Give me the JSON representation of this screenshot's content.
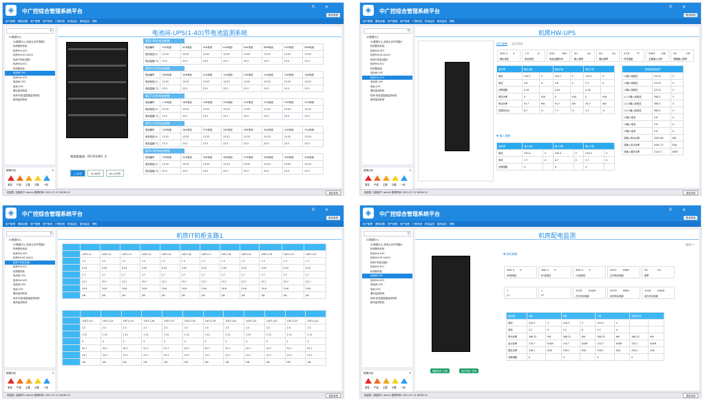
{
  "app": {
    "title": "中广控综合管理系统平台",
    "exit": "退出系统",
    "status": "欢迎您: 当前用户: admin   登录时间: 2021-07-12 08:56:10",
    "status_btn": "退出系统"
  },
  "menu": [
    "用户管理",
    "基础设置",
    "资产管理",
    "资产报表",
    "门禁系统",
    "机柜监控",
    "模块监控",
    "帮助"
  ],
  "tree": [
    {
      "l": "XX数据中心",
      "sub": false
    },
    {
      "l": "XX数据中心-机房主仓环境展示",
      "sub": true
    },
    {
      "l": "机房配电系统",
      "sub": true
    },
    {
      "l": "机房HW-UPS",
      "sub": true
    },
    {
      "l": "机房HW-KT-A0001",
      "sub": true
    },
    {
      "l": "机房IT机柜支路1",
      "sub": true
    },
    {
      "l": "机房HW-ECC",
      "sub": true
    },
    {
      "l": "机房配电柜",
      "sub": true
    },
    {
      "l": "电池间-UPS",
      "sub": true
    },
    {
      "l": "机房HW-UPS",
      "sub": true
    },
    {
      "l": "电池间-UPS",
      "sub": true
    },
    {
      "l": "电池-UPS",
      "sub": true
    },
    {
      "l": "漏水监测系统",
      "sub": true
    },
    {
      "l": "机房-机柜温湿度监测系统",
      "sub": true
    },
    {
      "l": "新风监测系统",
      "sub": true
    }
  ],
  "alarms": {
    "title": "报警分析",
    "count": "0",
    "labels": [
      "紧急",
      "严重",
      "主要",
      "次要",
      "一般"
    ],
    "colors": [
      "#e8262a",
      "#f36b1c",
      "#f5a31a",
      "#f5d21a",
      "#2a9df4"
    ]
  },
  "p1": {
    "title": "电池间-UPS(1-40)节电池监测系统",
    "battery_label": "电池组电流:",
    "battery_value": "DCV01081",
    "battery_unit": "A",
    "buttons": [
      "1-40节",
      "41-80节",
      "81-120节"
    ],
    "groups": [
      {
        "title": "第01-08节电池参数",
        "start": 1
      },
      {
        "title": "第09-16节电池参数",
        "start": 9
      },
      {
        "title": "第17-24节电池参数",
        "start": 17
      },
      {
        "title": "第25-32节电池参数",
        "start": 25
      },
      {
        "title": "第33-40节电池参数",
        "start": 33
      }
    ],
    "row_labels": [
      "电池编号",
      "电池电压(V)",
      "电池温度(℃)"
    ],
    "volt": "13.53",
    "temp": "23.3"
  },
  "p2": {
    "title": "机房HW-UPS",
    "tabs": [
      "运行参数",
      "运行状态"
    ],
    "params": [
      {
        "v": "400.3",
        "u": "V",
        "l": "输出电压"
      },
      {
        "v": "1.5",
        "u": "A",
        "l": "电池电流"
      },
      {
        "v": "200",
        "u": "Min",
        "l": "电池后备时间"
      },
      {
        "v": "50",
        "u": "Hz",
        "l": "输入频率"
      },
      {
        "v": "50",
        "u": "Hz",
        "l": "输出频率"
      },
      {
        "v": "23.8",
        "u": "℃",
        "l": "环境温度"
      },
      {
        "v": "5567",
        "u": "KW",
        "l": "主路输入功率"
      },
      {
        "v": "50",
        "u": "HZ",
        "l": "旁路输入频率"
      }
    ],
    "out_head": [
      "监测项",
      "输出A相",
      "输出B相",
      "输出C相"
    ],
    "out_rows": [
      [
        "电压",
        "220.2",
        "V",
        "220.1",
        "V",
        "220.3",
        "V"
      ],
      [
        "电流",
        "4.6",
        "A",
        "5.6",
        "A",
        "3.3",
        "A"
      ],
      [
        "功率因数",
        "0.16",
        "",
        "0.16",
        "",
        "0.16",
        ""
      ],
      [
        "视在功率",
        "0",
        "KVA",
        "0",
        "KVA",
        "0",
        "KVA"
      ],
      [
        "有功功率",
        "34.7",
        "KW",
        "34.7",
        "KW",
        "34.7",
        "KW"
      ],
      [
        "负载百分比",
        "6.7",
        "%",
        "7.3",
        "%",
        "5.2",
        "%"
      ]
    ],
    "in_title": "输入参数",
    "in_head": [
      "监测项",
      "输入A相",
      "输入B相",
      "输入C相"
    ],
    "in_rows": [
      [
        "电压",
        "220.4",
        "V",
        "220.4",
        "V",
        "220.4",
        "V"
      ],
      [
        "电流",
        "3.7",
        "A",
        "6.7",
        "A",
        "4.7",
        "A"
      ],
      [
        "功率因数",
        "0",
        "",
        "0",
        "",
        "0",
        ""
      ]
    ],
    "right_head": "其他参数监测项",
    "right_rows": [
      [
        "L1输入相电压",
        "221.6",
        "V"
      ],
      [
        "L2输入相电压",
        "221.6",
        "V"
      ],
      [
        "L3输入相电压",
        "221.6",
        "V"
      ],
      [
        "L1-L2输入线电压",
        "380.4",
        "V"
      ],
      [
        "L2-L3输入线电压",
        "380.4",
        "V"
      ],
      [
        "L3-L1输入线电压",
        "380.4",
        "V"
      ],
      [
        "L1输入电流",
        "5.8",
        "A"
      ],
      [
        "L2输入电流",
        "5.8",
        "A"
      ],
      [
        "L3输入电流",
        "5.8",
        "A"
      ],
      [
        "总输入有功功率",
        "3267.88",
        "KW"
      ],
      [
        "总输入无功功率",
        "4502.13",
        "KVA"
      ],
      [
        "总输入视在功率",
        "2134.7",
        "KWH"
      ]
    ]
  },
  "p3": {
    "title": "机房IT机柜支路1",
    "row_labels": [
      "",
      "",
      "",
      "",
      "",
      "",
      ""
    ],
    "t1_names": [
      "1QF1-L1",
      "1QF1-L2",
      "1QF1-L3",
      "1QF1-L4",
      "1QF1-L5",
      "1QF1-L6",
      "1QF1-L7",
      "1QF1-L8",
      "1QF1-L9",
      "1QF1-L10",
      "1QF1-L11",
      "1QF1-L12"
    ],
    "t1_rows": [
      "1.3",
      "0.43",
      "2.7",
      "23.7",
      "24.6",
      "ON"
    ],
    "t2_names": [
      "1QF1-L13",
      "1QF1-L14",
      "1QF1-L15",
      "1QF1-L16",
      "1QF1-L17",
      "1QF1-L18",
      "1QF1-L19",
      "1QF1-L20",
      "1QF1-L21",
      "1QF1-L22",
      "1QF1-L23",
      "1QF1-L24"
    ],
    "t2_rows": [
      "2.5",
      "1.12",
      "5",
      "52.7",
      "23.7",
      "ON"
    ]
  },
  "p4": {
    "title": "机房配电监测",
    "back": "返回>>",
    "section": "实时参数",
    "btn1": "储能状态: 正常",
    "btn2": "运行状态: 正常",
    "boxes1": [
      {
        "v": "380.3",
        "u": "V",
        "l": "AB线电压"
      },
      {
        "v": "380.3",
        "u": "V",
        "l": "BC线电压"
      },
      {
        "v": "380.3",
        "u": "V",
        "l": "CA线电压"
      },
      {
        "v": "2031",
        "u": "KWH",
        "l": "正向有功电能"
      },
      {
        "v": "50",
        "u": "Hz",
        "l": "频率"
      }
    ],
    "boxes2": [
      {
        "v": "1",
        "u": "",
        "l": "CT"
      },
      {
        "v": "1",
        "u": "",
        "l": "PT"
      },
      {
        "v": "1032",
        "u": "KVAR",
        "l": "正向无功电能"
      },
      {
        "v": "2033",
        "u": "KWH",
        "l": "反向有功电能"
      },
      {
        "v": "1034",
        "u": "KVAR",
        "l": "反向无功电能"
      }
    ],
    "head": [
      "监测项",
      "A相",
      "B相",
      "C相",
      "总或/平均"
    ],
    "rows": [
      [
        "电压",
        "220.3",
        "V",
        "220.3",
        "V",
        "220.3",
        "V",
        "",
        ""
      ],
      [
        "电流",
        "5.2",
        "A",
        "5.2",
        "A",
        "5.2",
        "A",
        "",
        ""
      ],
      [
        "有功功率",
        "368.32",
        "KW",
        "368.32",
        "KW",
        "368.32",
        "KW",
        "368.32",
        "KW"
      ],
      [
        "无功功率",
        "134.7",
        "KVAR",
        "134.7",
        "KVAR",
        "134.7",
        "KVAR",
        "134.7",
        "KVAR"
      ],
      [
        "视在功率",
        "236.1",
        "KVA",
        "236.1",
        "KVA",
        "236.1",
        "KVA",
        "236.1",
        "KVA"
      ],
      [
        "功率因数",
        "0",
        "",
        "0",
        "",
        "0",
        "",
        "0",
        ""
      ]
    ]
  }
}
